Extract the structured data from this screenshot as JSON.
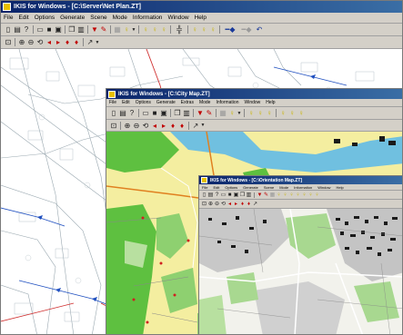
{
  "windows": {
    "main": {
      "title": "IKIS for Windows - [C:\\Server\\Net Plan.ZT]",
      "menu": [
        "File",
        "Edit",
        "Options",
        "Generate",
        "Scene",
        "Mode",
        "Information",
        "Window",
        "Help"
      ]
    },
    "middle": {
      "title": "IKIS for Windows - [C:\\City Map.ZT]",
      "menu": [
        "File",
        "Edit",
        "Options",
        "Generate",
        "Extras",
        "Mode",
        "Information",
        "Window",
        "Help"
      ]
    },
    "small": {
      "title": "IKIS for Windows - [C:\\Orientation Map.ZT]",
      "menu": [
        "File",
        "Edit",
        "Options",
        "Generate",
        "Scene",
        "Mode",
        "Information",
        "Window",
        "Help"
      ]
    }
  },
  "icons": {
    "row1": [
      "new-icon",
      "open-icon",
      "question-icon",
      "folder-icon",
      "save-icon",
      "print-icon",
      "copy-icon",
      "paste-icon",
      "filter-icon",
      "eraser-icon",
      "layer-icon",
      "lightbulb-icon",
      "lightbulb-icon",
      "lightbulb-icon",
      "lightbulb-icon",
      "lightbulb-icon",
      "network-icon",
      "lightbulb-icon",
      "lightbulb-icon",
      "lightbulb-icon",
      "line-arrow-icon",
      "line-dash-icon",
      "undo-icon"
    ],
    "row2": [
      "select-icon",
      "zoom-in-icon",
      "zoom-out-icon",
      "pan-icon",
      "arrow-left-icon",
      "arrow-right-icon",
      "pin-icon",
      "pin-icon",
      "measure-icon"
    ]
  },
  "colors": {
    "titlebar": "#0a246a",
    "toolbar": "#d4d0c8",
    "cad_line": "#9aa8b0",
    "cad_red": "#d03030",
    "cad_blue": "#2050c0",
    "map_yellow": "#f4eea0",
    "map_green": "#5ec040",
    "map_water": "#70c0e0",
    "map_building": "#1a1a1a"
  }
}
